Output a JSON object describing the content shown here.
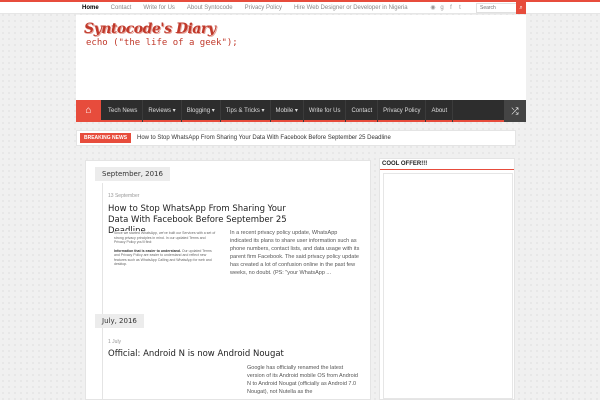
{
  "topnav": {
    "items": [
      "Home",
      "Contact",
      "Write for Us",
      "About Syntocode",
      "Privacy Policy",
      "Hire Web Designer or Developer in Nigeria"
    ]
  },
  "social_icons": [
    "rss-icon",
    "google-plus-icon",
    "facebook-icon",
    "twitter-icon"
  ],
  "search": {
    "placeholder": "Search"
  },
  "logo": {
    "title": "Syntocode's Diary",
    "subtitle": "echo (\"the life of a geek\");"
  },
  "mainnav": {
    "items": [
      "Tech News",
      "Reviews ▾",
      "Blogging ▾",
      "Tips & Tricks ▾",
      "Mobile ▾",
      "Write for Us",
      "Contact",
      "Privacy Policy",
      "About"
    ]
  },
  "breaking": {
    "label": "Breaking News",
    "text": "How to Stop WhatsApp From Sharing Your Data With Facebook Before September 25 Deadline"
  },
  "timeline": [
    {
      "month": "September, 2016",
      "date": "13 September",
      "title": "How to Stop WhatsApp From Sharing Your Data With Facebook Before September 25 Deadline",
      "thumb_text_1": "Since we started WhatsApp, we've built our Services with a set of strong privacy principles in mind. In our updated Terms and Privacy Policy you'll find:",
      "thumb_text_2_bold": "Information that is easier to understand.",
      "thumb_text_2": " Our updated Terms and Privacy Policy are easier to understand and reflect new features such as WhatsApp Calling and WhatsApp for web and desktop.",
      "excerpt": "In a recent privacy policy update, WhatsApp indicated its plans to share user information such as phone numbers, contact lists, and data usage with its parent firm Facebook. The said privacy policy update has created a lot of confusion online in the past few weeks, no doubt. (PS: \"your WhatsApp ..."
    },
    {
      "month": "July, 2016",
      "date": "1 July",
      "title": "Official: Android N is now Android Nougat",
      "excerpt": "Google has officially renamed the latest version of its Android mobile OS from Android N to Android Nougat (officially as Android 7.0 Nougat), not Nutella as the"
    }
  ],
  "sidebar": {
    "widget_title": "COOL OFFER!!!"
  },
  "colors": {
    "accent": "#e74c3c",
    "nav_bg": "#2d2d2d"
  }
}
